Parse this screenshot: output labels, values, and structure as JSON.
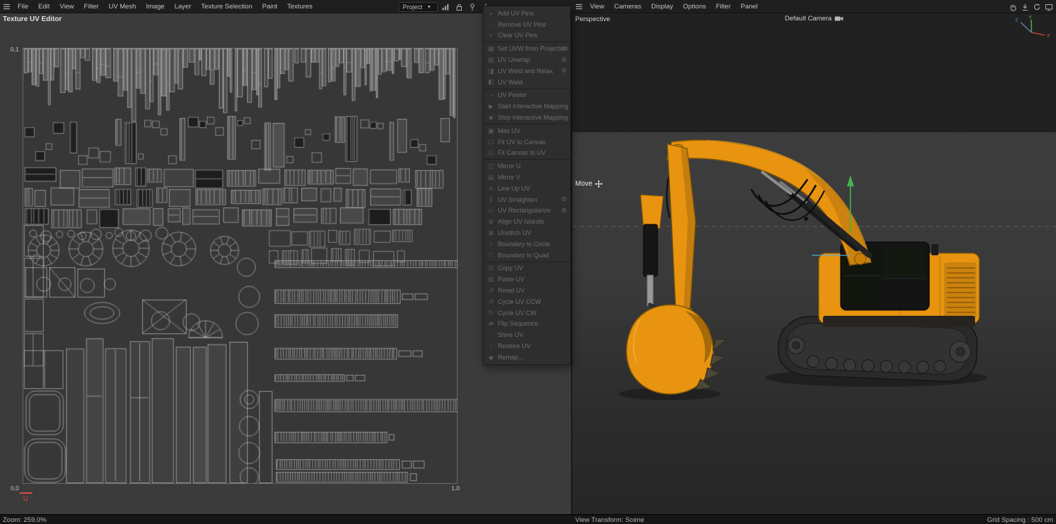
{
  "colors": {
    "accent_orange": "#e89410",
    "accent_orange_dark": "#b5720a",
    "mesh_stroke": "#dddddd",
    "uv_canvas_bg": "#373737",
    "gizmo_green": "#46b14f",
    "gizmo_cyan": "#54aed0",
    "axis_x": "#d14b3a",
    "axis_y": "#63b250",
    "axis_z": "#5a82c9",
    "axis_u_red": "#de4a3f"
  },
  "menubar_left": {
    "items": [
      "File",
      "Edit",
      "View",
      "Filter",
      "UV Mesh",
      "Image",
      "Layer",
      "Texture Selection",
      "Paint",
      "Textures"
    ],
    "project_dropdown": {
      "value": "Project"
    },
    "icons": [
      "chart-icon",
      "lock-icon",
      "pin-icon",
      "download-icon"
    ]
  },
  "menubar_right": {
    "items": [
      "View",
      "Cameras",
      "Display",
      "Options",
      "Filter",
      "Panel"
    ],
    "icons": [
      "hand-icon",
      "download-icon",
      "sync-icon",
      "screen-icon"
    ]
  },
  "uv_editor": {
    "title": "Texture UV Editor",
    "corners": {
      "top_left": "0,1",
      "bottom_left": "0,0",
      "bottom_right": "1,0"
    },
    "axis_u_label": "U",
    "zoom_status": "Zoom: 259.0%"
  },
  "uv_menu": {
    "gear_icon": "⚙",
    "groups": [
      {
        "items": [
          {
            "label": "Add UV Pins",
            "icon": "+"
          },
          {
            "label": "Remove UV Pins",
            "icon": "−"
          },
          {
            "label": "Clear UV Pins",
            "icon": "×"
          }
        ]
      },
      {
        "items": [
          {
            "label": "Set UVW from Projection",
            "icon": "▦",
            "gear": true
          },
          {
            "label": "UV Unwrap",
            "icon": "▧",
            "gear": true
          },
          {
            "label": "UV Weld and Relax",
            "icon": "◨",
            "gear": true
          },
          {
            "label": "UV Weld",
            "icon": "◧"
          }
        ]
      },
      {
        "items": [
          {
            "label": "UV Peeler",
            "icon": "◔"
          },
          {
            "label": "Start Interactive Mapping",
            "icon": "▶"
          },
          {
            "label": "Stop Interactive Mapping",
            "icon": "■"
          }
        ]
      },
      {
        "items": [
          {
            "label": "Max UV",
            "icon": "▣"
          },
          {
            "label": "Fit UV to Canvas",
            "icon": "▢"
          },
          {
            "label": "Fit Canvas to UV",
            "icon": "◱"
          }
        ]
      },
      {
        "items": [
          {
            "label": "Mirror U",
            "icon": "◫"
          },
          {
            "label": "Mirror V",
            "icon": "▤"
          },
          {
            "label": "Line Up UV",
            "icon": "≡"
          },
          {
            "label": "UV Straighten",
            "icon": "∥",
            "gear": true
          },
          {
            "label": "UV Rectangularize",
            "icon": "▭",
            "gear": true
          },
          {
            "label": "Align UV Islands",
            "icon": "⊞"
          },
          {
            "label": "Unstitch UV",
            "icon": "⊠"
          },
          {
            "label": "Boundary to Circle",
            "icon": "○"
          },
          {
            "label": "Boundary to Quad",
            "icon": "□"
          }
        ]
      },
      {
        "items": [
          {
            "label": "Copy UV",
            "icon": "⊡"
          },
          {
            "label": "Paste UV",
            "icon": "▥"
          },
          {
            "label": "Reset UV",
            "icon": "↺"
          },
          {
            "label": "Cycle UV CCW",
            "icon": "↺"
          },
          {
            "label": "Cycle UV CW",
            "icon": "↻"
          },
          {
            "label": "Flip Sequence",
            "icon": "⇄"
          },
          {
            "label": "Store UV",
            "icon": "↓"
          },
          {
            "label": "Restore UV",
            "icon": "↑"
          },
          {
            "label": "Remap...",
            "icon": "◆"
          }
        ]
      }
    ]
  },
  "viewport": {
    "view_label": "Perspective",
    "camera_label": "Default Camera",
    "tool_label": "Move",
    "axis_gizmo": {
      "x": "X",
      "y": "Y",
      "z": "Z"
    },
    "status_left": "View Transform: Scene",
    "status_right": "Grid Spacing : 500 cm"
  }
}
